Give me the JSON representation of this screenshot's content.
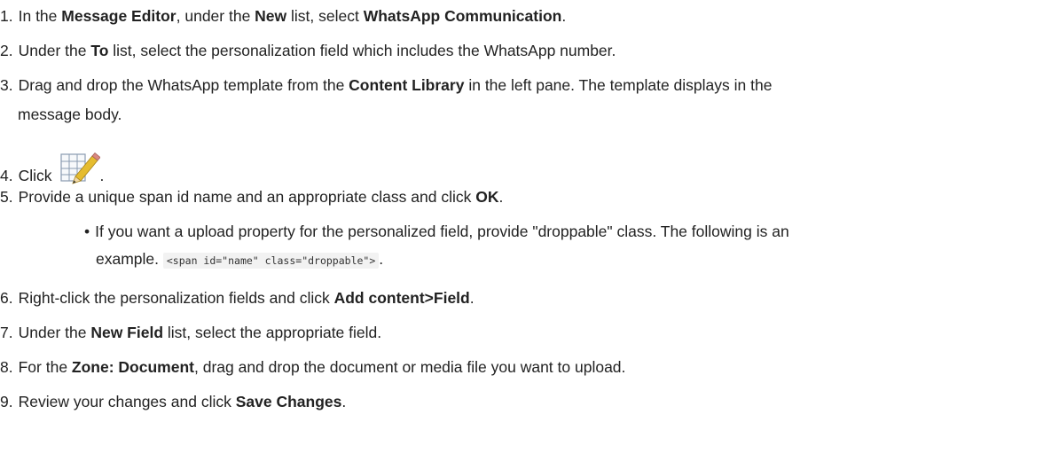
{
  "steps": [
    {
      "num": "1.",
      "parts": [
        {
          "t": "In the "
        },
        {
          "t": "Message Editor",
          "b": true
        },
        {
          "t": ", under the "
        },
        {
          "t": "New",
          "b": true
        },
        {
          "t": " list, select "
        },
        {
          "t": "WhatsApp Communication",
          "b": true
        },
        {
          "t": "."
        }
      ]
    },
    {
      "num": "2.",
      "parts": [
        {
          "t": "Under the "
        },
        {
          "t": "To",
          "b": true
        },
        {
          "t": " list, select the personalization field which includes the WhatsApp number."
        }
      ]
    },
    {
      "num": "3.",
      "parts": [
        {
          "t": "Drag and drop the WhatsApp template from the "
        },
        {
          "t": "Content Library",
          "b": true
        },
        {
          "t": " in the left pane. The template displays in the"
        }
      ],
      "continuation": "message body."
    },
    {
      "num": "4.",
      "before_icon": "Click",
      "icon": "edit-table-icon",
      "after_icon": "."
    },
    {
      "num": "5.",
      "parts": [
        {
          "t": "Provide a unique span id name and an appropriate class and click "
        },
        {
          "t": "OK",
          "b": true
        },
        {
          "t": "."
        }
      ],
      "sub": {
        "bullet": "•",
        "line1": "If you want a upload property for the personalized field, provide \"droppable\" class. The following is an",
        "line2_prefix": "example. ",
        "code": "<span id=\"name\" class=\"droppable\">",
        "line2_suffix": "."
      }
    },
    {
      "num": "6.",
      "parts": [
        {
          "t": "Right-click the personalization fields and click "
        },
        {
          "t": "Add content>Field",
          "b": true
        },
        {
          "t": "."
        }
      ]
    },
    {
      "num": "7.",
      "parts": [
        {
          "t": "Under the "
        },
        {
          "t": "New Field",
          "b": true
        },
        {
          "t": " list, select the appropriate field."
        }
      ]
    },
    {
      "num": "8.",
      "parts": [
        {
          "t": "For the "
        },
        {
          "t": "Zone: Document",
          "b": true
        },
        {
          "t": ", drag and drop the document or media file you want to upload."
        }
      ]
    },
    {
      "num": "9.",
      "parts": [
        {
          "t": "Review your changes and click "
        },
        {
          "t": "Save Changes",
          "b": true
        },
        {
          "t": "."
        }
      ]
    }
  ]
}
